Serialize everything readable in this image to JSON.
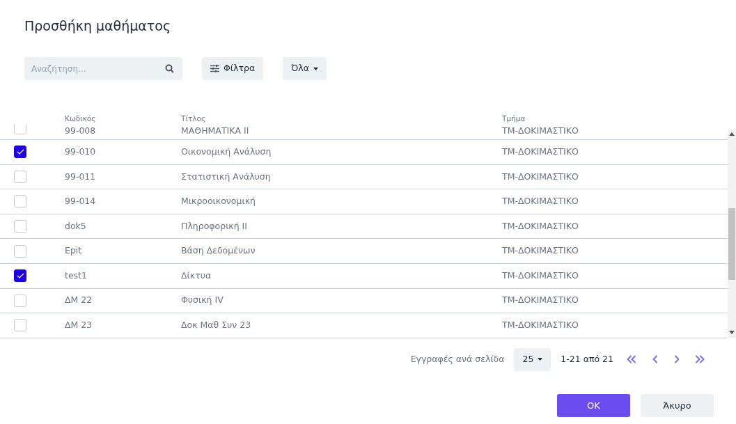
{
  "dialog": {
    "title": "Προσθήκη μαθήματος"
  },
  "search": {
    "placeholder": "Αναζήτηση..."
  },
  "filters_button": {
    "label": "Φίλτρα"
  },
  "scope_dropdown": {
    "label": "Όλα"
  },
  "table": {
    "columns": [
      "Κωδικός",
      "Τίτλος",
      "Τμήμα"
    ],
    "rows": [
      {
        "code": "99-008",
        "title": "ΜΑΘΗΜΑΤΙΚΑ ΙΙ",
        "department": "ΤΜ-ΔΟΚΙΜΑΣΤΙΚΟ",
        "checked": false
      },
      {
        "code": "99-010",
        "title": "Οικονομική Ανάλυση",
        "department": "ΤΜ-ΔΟΚΙΜΑΣΤΙΚΟ",
        "checked": true
      },
      {
        "code": "99-011",
        "title": "Στατιστική Ανάλυση",
        "department": "ΤΜ-ΔΟΚΙΜΑΣΤΙΚΟ",
        "checked": false
      },
      {
        "code": "99-014",
        "title": "Μικροοικονομική",
        "department": "ΤΜ-ΔΟΚΙΜΑΣΤΙΚΟ",
        "checked": false
      },
      {
        "code": "dok5",
        "title": "Πληροφορική ΙΙ",
        "department": "ΤΜ-ΔΟΚΙΜΑΣΤΙΚΟ",
        "checked": false
      },
      {
        "code": "Epit",
        "title": "Βάση Δεδομένων",
        "department": "ΤΜ-ΔΟΚΙΜΑΣΤΙΚΟ",
        "checked": false
      },
      {
        "code": "test1",
        "title": "Δίκτυα",
        "department": "ΤΜ-ΔΟΚΙΜΑΣΤΙΚΟ",
        "checked": true
      },
      {
        "code": "ΔΜ 22",
        "title": "Φυσική IV",
        "department": "ΤΜ-ΔΟΚΙΜΑΣΤΙΚΟ",
        "checked": false
      },
      {
        "code": "ΔΜ 23",
        "title": "Δοκ Μαθ Συν 23",
        "department": "ΤΜ-ΔΟΚΙΜΑΣΤΙΚΟ",
        "checked": false
      }
    ]
  },
  "pagination": {
    "rows_per_page_label": "Εγγραφές ανά σελίδα",
    "rows_per_page": "25",
    "range": "1-21 από 21"
  },
  "buttons": [
    {
      "label": "OK",
      "kind": "primary"
    },
    {
      "label": "Άκυρο",
      "kind": "secondary"
    }
  ]
}
